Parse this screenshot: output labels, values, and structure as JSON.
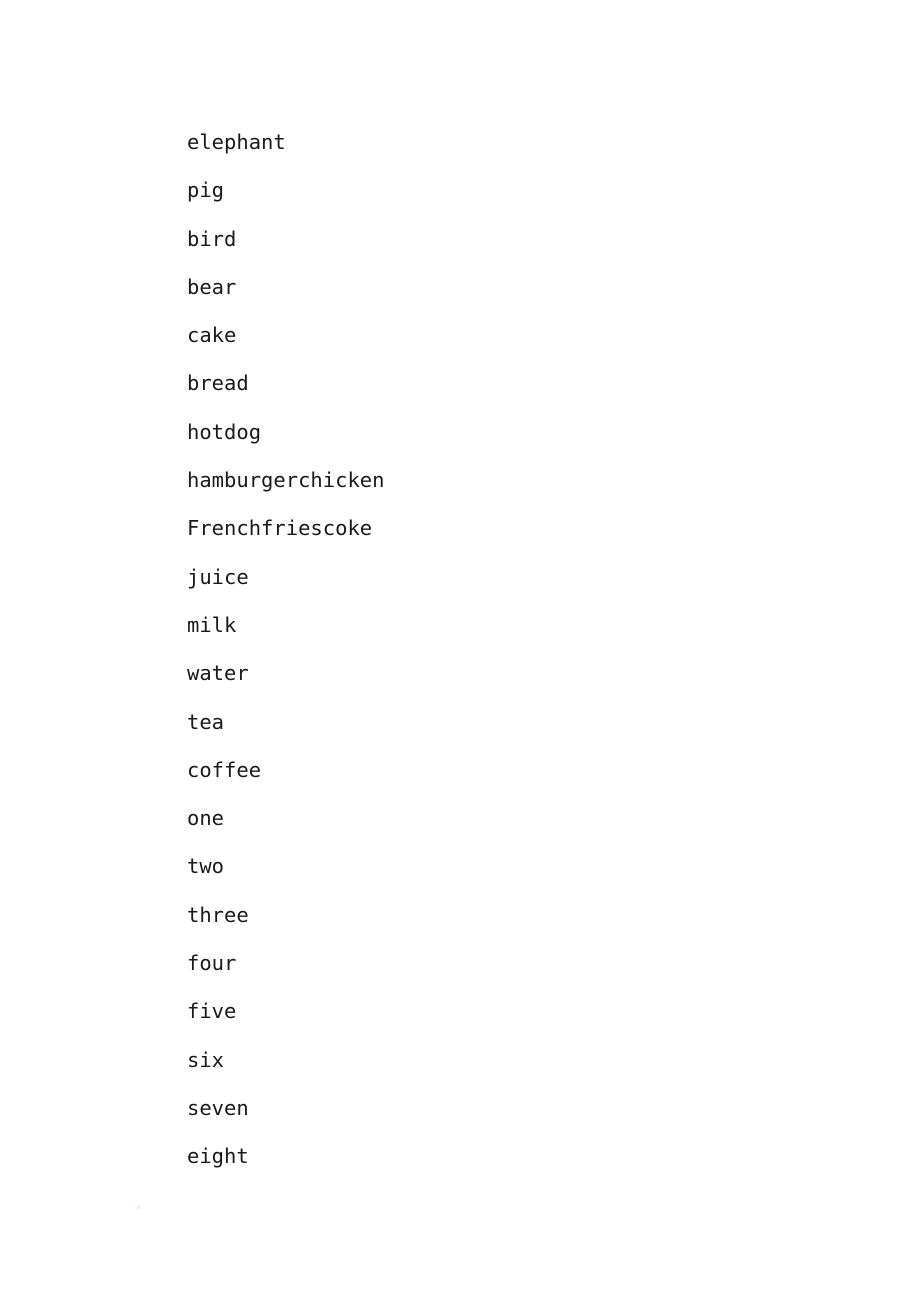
{
  "document": {
    "page_background": "#ffffff",
    "text_color": "#1a1a1a",
    "word_list": [
      {
        "text": "elephant"
      },
      {
        "text": "pig"
      },
      {
        "text": "bird"
      },
      {
        "text": "bear"
      },
      {
        "text": "cake"
      },
      {
        "text": "bread"
      },
      {
        "text": "hotdog"
      },
      {
        "text": "hamburgerchicken"
      },
      {
        "text": "Frenchfriescoke"
      },
      {
        "text": "juice"
      },
      {
        "text": "milk"
      },
      {
        "text": "water"
      },
      {
        "text": "tea"
      },
      {
        "text": "coffee"
      },
      {
        "text": "one"
      },
      {
        "text": "two"
      },
      {
        "text": "three"
      },
      {
        "text": "four"
      },
      {
        "text": "five"
      },
      {
        "text": "six"
      },
      {
        "text": "seven"
      },
      {
        "text": "eight"
      }
    ]
  },
  "artifacts": {
    "scan_speck_color": "#f2c8e0"
  }
}
